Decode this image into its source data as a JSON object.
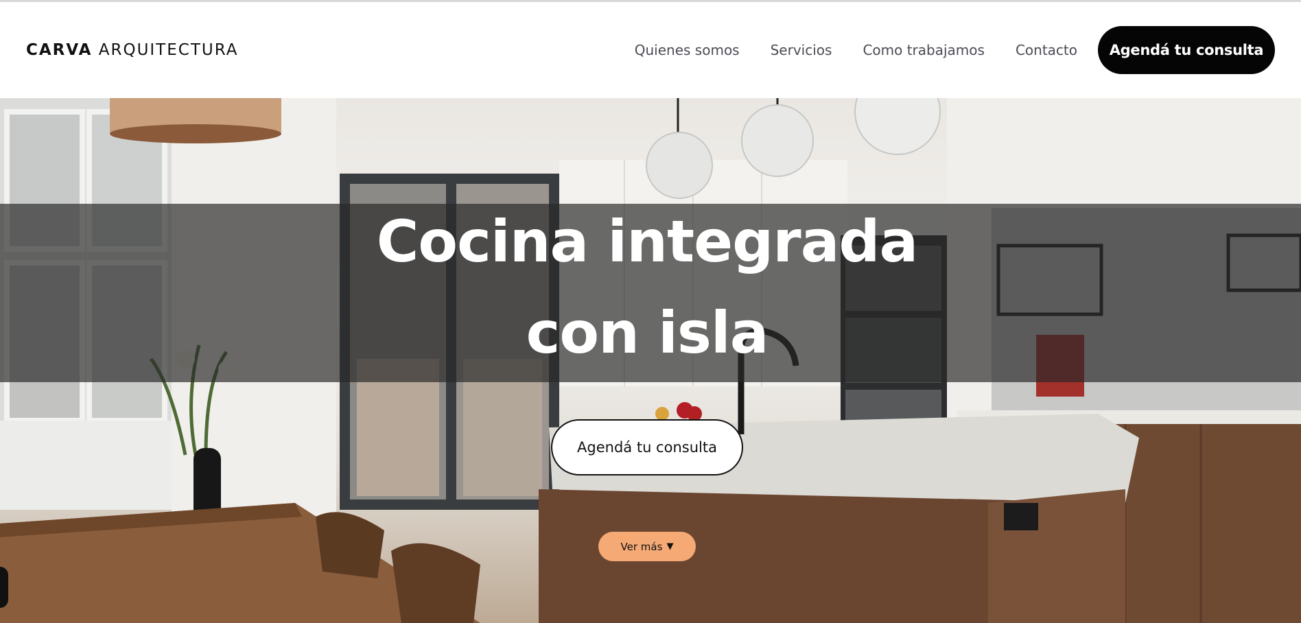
{
  "brand": {
    "name_bold": "CARVA",
    "name_light": "ARQUITECTURA"
  },
  "nav": {
    "items": [
      {
        "label": "Quienes somos"
      },
      {
        "label": "Servicios"
      },
      {
        "label": "Como trabajamos"
      },
      {
        "label": "Contacto"
      }
    ],
    "cta_label": "Agendá tu consulta"
  },
  "hero": {
    "title_line1": "Cocina integrada",
    "title_line2": "con isla",
    "cta_label": "Agendá tu consulta",
    "more_label": "Ver más",
    "more_icon": "caret-down-icon"
  },
  "colors": {
    "header_bg": "#ffffff",
    "cta_dark": "#050505",
    "more_button": "#f5a975",
    "band_overlay": "rgba(40,40,40,0.68)"
  }
}
